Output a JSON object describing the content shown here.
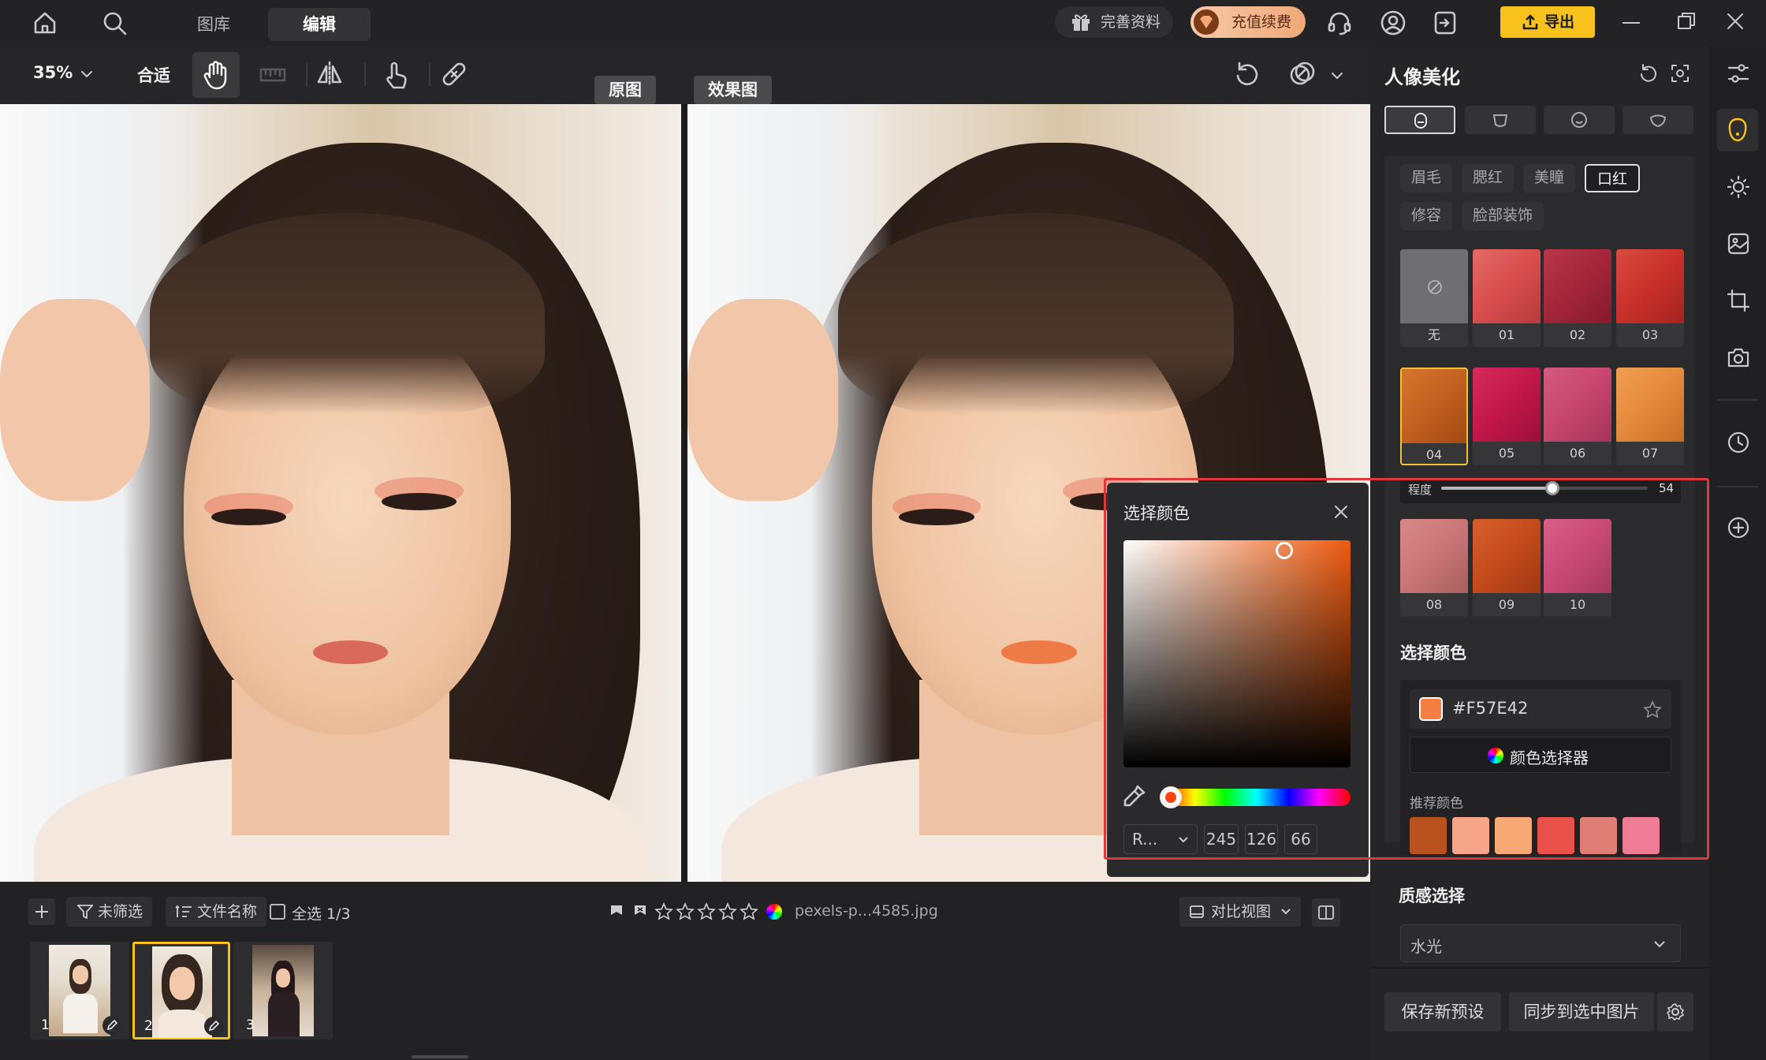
{
  "topbar": {
    "tabs": [
      "图库",
      "编辑"
    ],
    "active_tab": "编辑",
    "profile_button": "完善资料",
    "recharge_button": "充值续费",
    "export_button": "导出"
  },
  "toolbar": {
    "zoom": "35%",
    "fit": "合适"
  },
  "canvas": {
    "original_label": "原图",
    "result_label": "效果图"
  },
  "picker": {
    "title": "选择颜色",
    "mode": "R...",
    "r": "245",
    "g": "126",
    "b": "66",
    "hue_color": "#EE5A0E",
    "selected_color": "#F57E42"
  },
  "panel": {
    "title": "人像美化",
    "subtabs": [
      "眉毛",
      "腮红",
      "美瞳",
      "口红",
      "修容",
      "脸部装饰"
    ],
    "active_subtab": "口红",
    "swatches": [
      {
        "label": "无",
        "color": "#6f6f73"
      },
      {
        "label": "01",
        "color": "#d9504f"
      },
      {
        "label": "02",
        "color": "#a3253a"
      },
      {
        "label": "03",
        "color": "#c9302a"
      },
      {
        "label": "04",
        "color": "#c2601f"
      },
      {
        "label": "05",
        "color": "#c2174a"
      },
      {
        "label": "06",
        "color": "#c6466f"
      },
      {
        "label": "07",
        "color": "#e48a3c"
      },
      {
        "label": "08",
        "color": "#c97676"
      },
      {
        "label": "09",
        "color": "#c44a1c"
      },
      {
        "label": "10",
        "color": "#c84a74"
      }
    ],
    "selected_swatch": "04",
    "intensity_label": "程度",
    "intensity_value": "54",
    "intensity": 0.54,
    "select_color_title": "选择颜色",
    "hex_value": "#F57E42",
    "color_picker_button": "颜色选择器",
    "recommended_title": "推荐颜色",
    "recommended_colors": [
      "#b8531f",
      "#f8a68a",
      "#f7a874",
      "#e9514a",
      "#e07d75",
      "#ef7c97"
    ],
    "texture_title": "质感选择",
    "texture_value": "水光",
    "save_preset": "保存新预设",
    "sync_button": "同步到选中图片"
  },
  "bottombar": {
    "filter": "未筛选",
    "sort": "文件名称",
    "select_all": "全选 1/3",
    "filename": "pexels-p...4585.jpg",
    "compare_view": "对比视图",
    "thumbnails": [
      "1",
      "2",
      "3"
    ],
    "active_thumbnail": "2"
  }
}
